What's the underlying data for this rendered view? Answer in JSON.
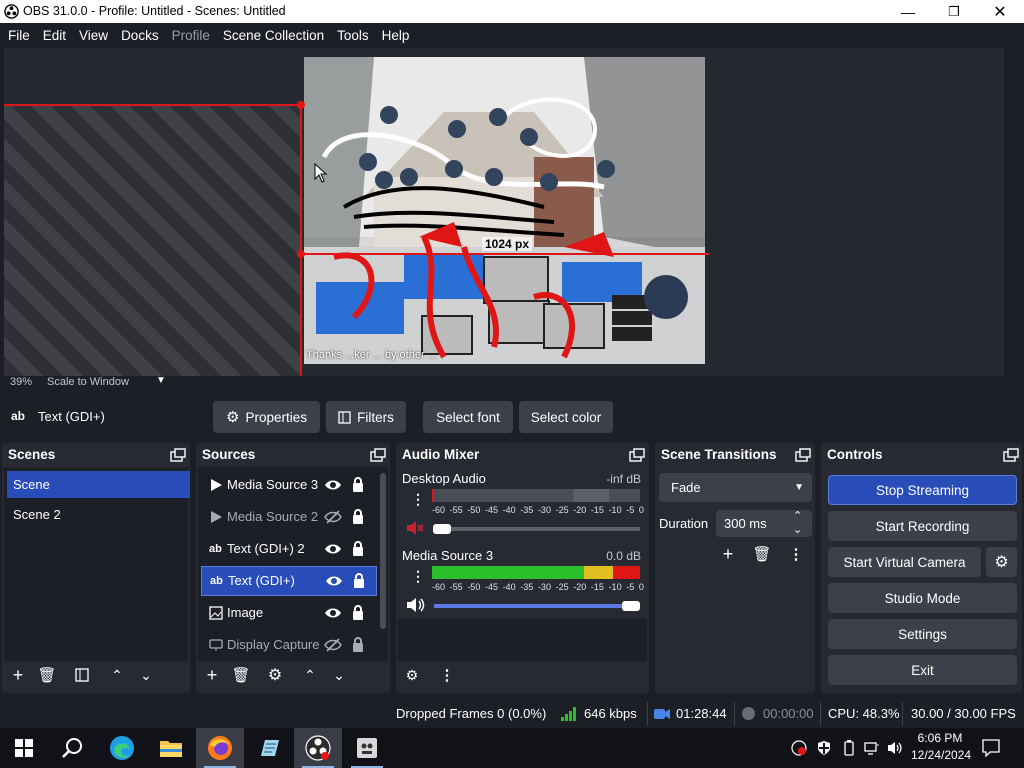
{
  "window": {
    "title": "OBS 31.0.0 - Profile: Untitled - Scenes: Untitled"
  },
  "menu": [
    "File",
    "Edit",
    "View",
    "Docks",
    "Profile",
    "Scene Collection",
    "Tools",
    "Help"
  ],
  "preview": {
    "zoom": "39%",
    "scale_mode": "Scale to Window",
    "size_label": "1024 px",
    "caption": "Thanks ...ker ... by other ...",
    "cursor": "arrow-cursor-icon"
  },
  "source_toolbar": {
    "selected_source": "Text (GDI+)",
    "buttons": [
      "Properties",
      "Filters",
      "Select font",
      "Select color"
    ]
  },
  "scenes": {
    "title": "Scenes",
    "items": [
      "Scene",
      "Scene 2"
    ],
    "selected": 0
  },
  "sources": {
    "title": "Sources",
    "items": [
      {
        "label": "Media Source 3",
        "icon": "play-icon",
        "visible": true,
        "locked": true
      },
      {
        "label": "Media Source 2",
        "icon": "play-icon",
        "visible": false,
        "locked": true
      },
      {
        "label": "Text (GDI+) 2",
        "icon": "text-ab-icon",
        "visible": true,
        "locked": true
      },
      {
        "label": "Text (GDI+)",
        "icon": "text-ab-icon",
        "visible": true,
        "locked": true
      },
      {
        "label": "Image",
        "icon": "image-icon",
        "visible": true,
        "locked": true
      },
      {
        "label": "Display Capture",
        "icon": "monitor-icon",
        "visible": false,
        "locked": true
      }
    ],
    "selected": 3
  },
  "audio_mixer": {
    "title": "Audio Mixer",
    "tick_labels": [
      "-60",
      "-55",
      "-50",
      "-45",
      "-40",
      "-35",
      "-30",
      "-25",
      "-20",
      "-15",
      "-10",
      "-5",
      "0"
    ],
    "channels": [
      {
        "name": "Desktop Audio",
        "db": "-inf dB",
        "muted": true,
        "volume": 0.0
      },
      {
        "name": "Media Source 3",
        "db": "0.0 dB",
        "muted": false,
        "volume": 1.0
      }
    ]
  },
  "transitions": {
    "title": "Scene Transitions",
    "type": "Fade",
    "duration_label": "Duration",
    "duration": "300 ms"
  },
  "controls": {
    "title": "Controls",
    "buttons": [
      "Stop Streaming",
      "Start Recording",
      "Start Virtual Camera",
      "Studio Mode",
      "Settings",
      "Exit"
    ]
  },
  "status": {
    "dropped_frames": "Dropped Frames 0 (0.0%)",
    "bitrate": "646 kbps",
    "stream_time": "01:28:44",
    "record_time": "00:00:00",
    "cpu": "CPU: 48.3%",
    "fps": "30.00 / 30.00 FPS"
  },
  "taskbar": {
    "apps": [
      "start-icon",
      "search-icon",
      "edge-icon",
      "file-explorer-icon",
      "firefox-icon",
      "notepad-icon",
      "obs-icon",
      "app-icon"
    ],
    "time": "6:06 PM",
    "date": "12/24/2024"
  },
  "colors": {
    "accent": "#284cb8",
    "bg": "#1d1f26",
    "dock": "#272a33",
    "button": "#3c404b"
  }
}
